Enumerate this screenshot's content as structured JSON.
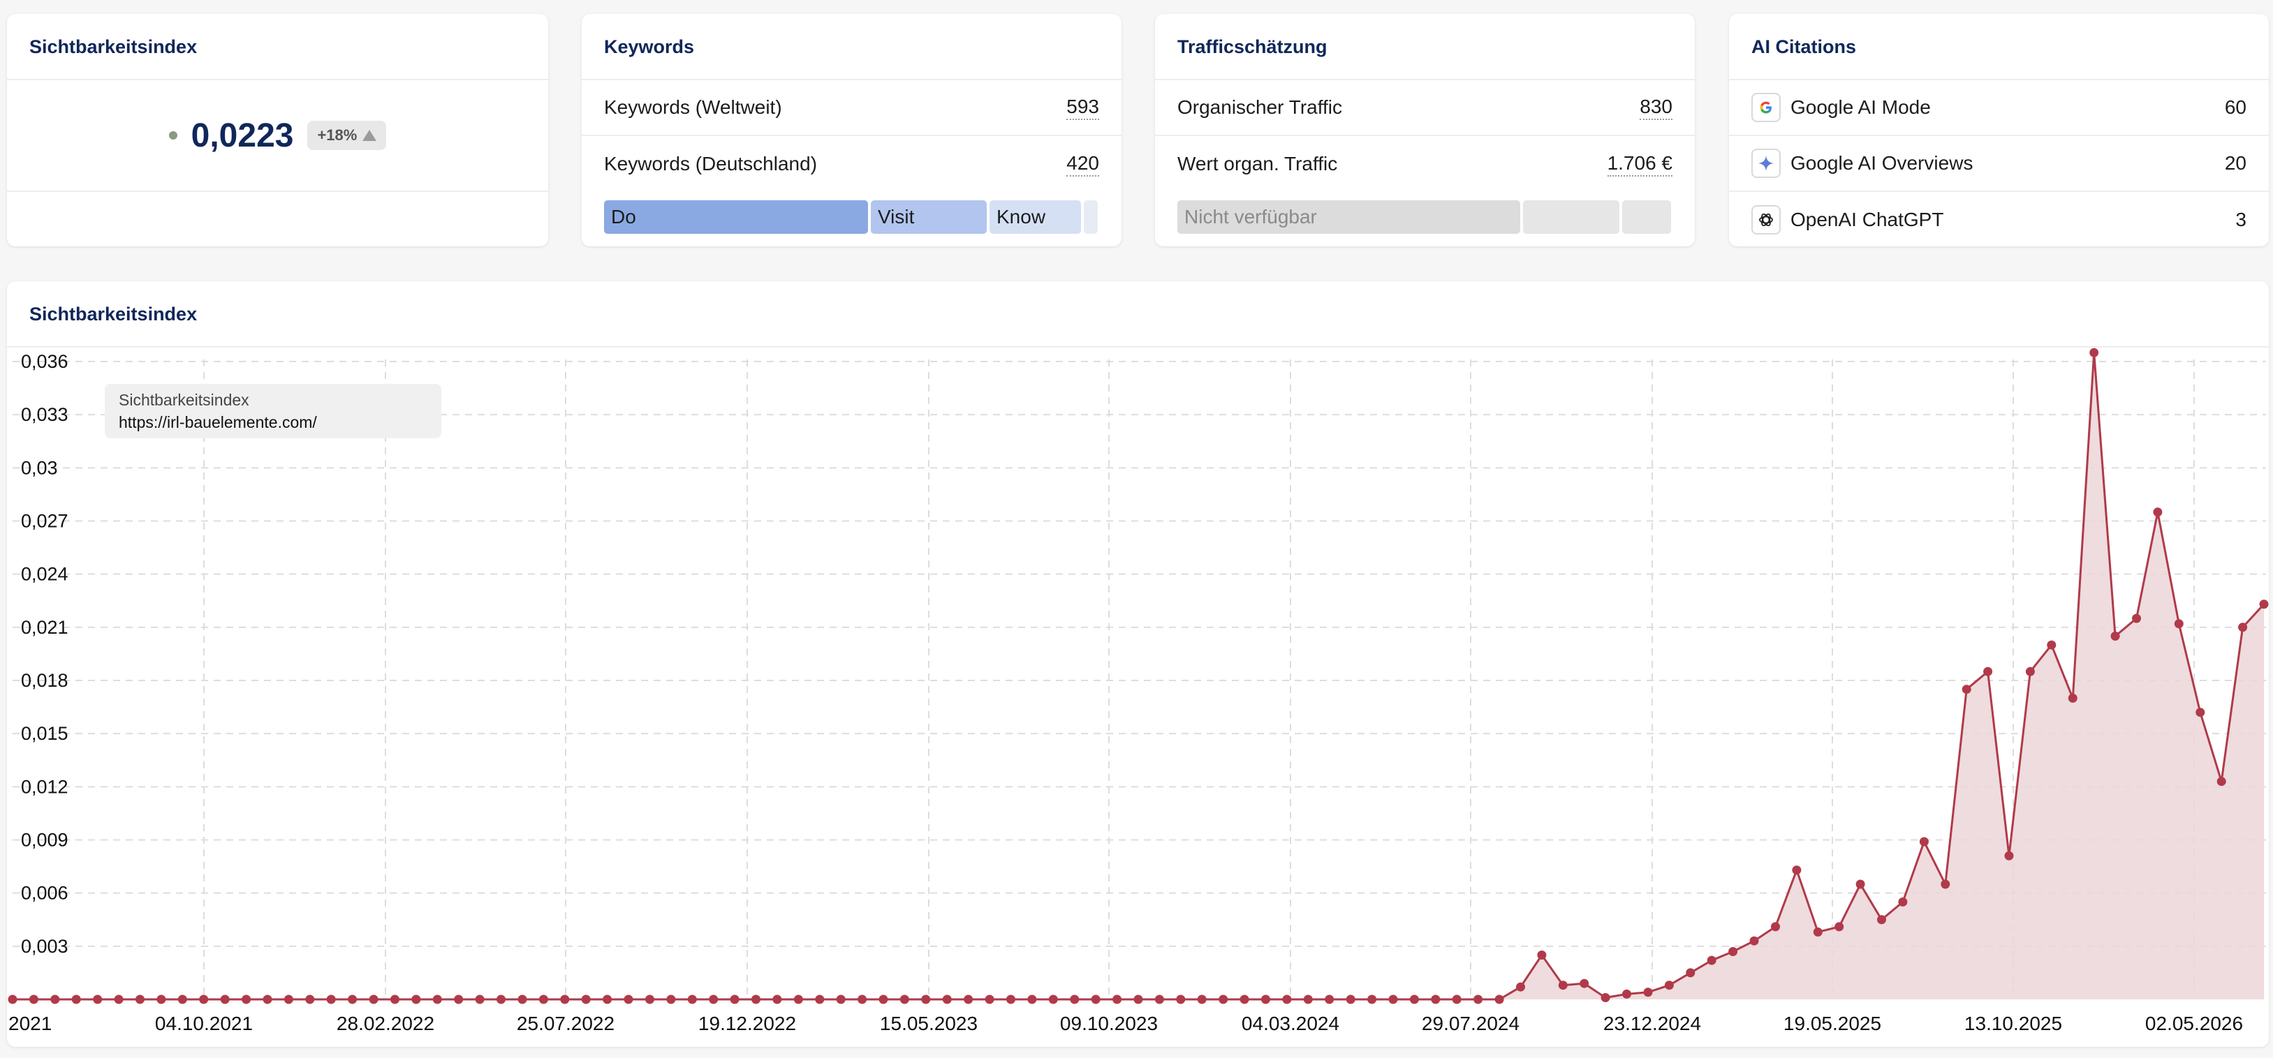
{
  "cards": {
    "visibility": {
      "title": "Sichtbarkeitsindex",
      "value": "0,0223",
      "change": "+18%"
    },
    "keywords": {
      "title": "Keywords",
      "rows": [
        {
          "label": "Keywords (Weltweit)",
          "value": "593"
        },
        {
          "label": "Keywords (Deutschland)",
          "value": "420"
        }
      ],
      "intents": [
        {
          "label": "Do",
          "color": "#8aa9e2"
        },
        {
          "label": "Visit",
          "color": "#b2c5ee"
        },
        {
          "label": "Know",
          "color": "#d5e0f5"
        },
        {
          "label": "",
          "color": "#e7ecf4"
        }
      ]
    },
    "traffic": {
      "title": "Trafficschätzung",
      "rows": [
        {
          "label": "Organischer Traffic",
          "value": "830"
        },
        {
          "label": "Wert organ. Traffic",
          "value": "1.706 €"
        }
      ],
      "unavailable": "Nicht verfügbar"
    },
    "ai": {
      "title": "AI Citations",
      "rows": [
        {
          "label": "Google AI Mode",
          "value": "60",
          "icon": "google-icon"
        },
        {
          "label": "Google AI Overviews",
          "value": "20",
          "icon": "sparkle-icon"
        },
        {
          "label": "OpenAI ChatGPT",
          "value": "3",
          "icon": "openai-icon"
        }
      ]
    }
  },
  "chart_section": {
    "title": "Sichtbarkeitsindex",
    "tooltip": {
      "label": "Sichtbarkeitsindex",
      "url": "https://irl-bauelemente.com/"
    }
  },
  "colors": {
    "line": "#b03a4a",
    "fill": "#ecd6d8",
    "title": "#10275a"
  },
  "chart_data": {
    "type": "area",
    "title": "",
    "xlabel": "",
    "ylabel": "",
    "ylim": [
      0,
      0.037
    ],
    "y_ticks": [
      "0,003",
      "0,006",
      "0,009",
      "0,012",
      "0,015",
      "0,018",
      "0,021",
      "0,024",
      "0,027",
      "0,03",
      "0,033",
      "0,036"
    ],
    "x_ticks": [
      "2021",
      "04.10.2021",
      "28.02.2022",
      "25.07.2022",
      "19.12.2022",
      "15.05.2023",
      "09.10.2023",
      "04.03.2024",
      "29.07.2024",
      "23.12.2024",
      "19.05.2025",
      "13.10.2025",
      "02.05.2026"
    ],
    "series": [
      {
        "values": [
          0,
          0,
          0,
          0,
          0,
          0,
          0,
          0,
          0,
          0,
          0,
          0,
          0,
          0,
          0,
          0,
          0,
          0,
          0,
          0,
          0,
          0,
          0,
          0,
          0,
          0,
          0,
          0,
          0,
          0,
          0,
          0,
          0,
          0,
          0,
          0,
          0,
          0,
          0,
          0,
          0,
          0,
          0,
          0,
          0,
          0,
          0,
          0,
          0,
          0,
          0,
          0,
          0,
          0,
          0,
          0,
          0,
          0,
          0,
          0,
          0,
          0,
          0,
          0,
          0,
          0,
          0,
          0,
          0,
          0,
          0,
          0.0007,
          0.0025,
          0.0008,
          0.0009,
          0.0001,
          0.0003,
          0.0004,
          0.0008,
          0.0015,
          0.0022,
          0.0027,
          0.0033,
          0.0041,
          0.0073,
          0.0038,
          0.0041,
          0.0065,
          0.0045,
          0.0055,
          0.0089,
          0.0065,
          0.0175,
          0.0185,
          0.0081,
          0.0185,
          0.02,
          0.017,
          0.0365,
          0.0205,
          0.0215,
          0.0275,
          0.0212,
          0.0162,
          0.0123,
          0.021,
          0.0223
        ]
      }
    ]
  }
}
